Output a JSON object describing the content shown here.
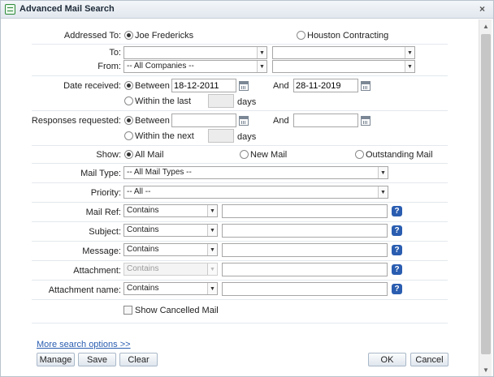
{
  "window": {
    "title": "Advanced Mail Search",
    "close": "×"
  },
  "addressed_to": {
    "label": "Addressed To:",
    "option1": "Joe Fredericks",
    "option2": "Houston Contracting"
  },
  "to": {
    "label": "To:",
    "value1": "",
    "value2": ""
  },
  "from": {
    "label": "From:",
    "value1": "-- All Companies --",
    "value2": ""
  },
  "date_received": {
    "label": "Date received:",
    "between": "Between",
    "start": "18-12-2011",
    "and": "And",
    "end": "28-11-2019",
    "within": "Within the last",
    "days": "days",
    "within_value": ""
  },
  "responses": {
    "label": "Responses requested:",
    "between": "Between",
    "start": "",
    "and": "And",
    "end": "",
    "within": "Within the next",
    "days": "days",
    "within_value": ""
  },
  "show": {
    "label": "Show:",
    "all": "All Mail",
    "new": "New Mail",
    "outstanding": "Outstanding Mail"
  },
  "mail_type": {
    "label": "Mail Type:",
    "value": "-- All Mail Types --"
  },
  "priority": {
    "label": "Priority:",
    "value": "-- All --"
  },
  "filters": [
    {
      "label": "Mail Ref:",
      "op": "Contains",
      "value": ""
    },
    {
      "label": "Subject:",
      "op": "Contains",
      "value": ""
    },
    {
      "label": "Message:",
      "op": "Contains",
      "value": ""
    },
    {
      "label": "Attachment:",
      "op": "Contains",
      "value": ""
    },
    {
      "label": "Attachment name:",
      "op": "Contains",
      "value": ""
    }
  ],
  "help_glyph": "?",
  "show_cancelled": "Show Cancelled Mail",
  "more_options": "More search options >>",
  "buttons": {
    "manage": "Manage",
    "save": "Save",
    "clear": "Clear",
    "ok": "OK",
    "cancel": "Cancel"
  }
}
